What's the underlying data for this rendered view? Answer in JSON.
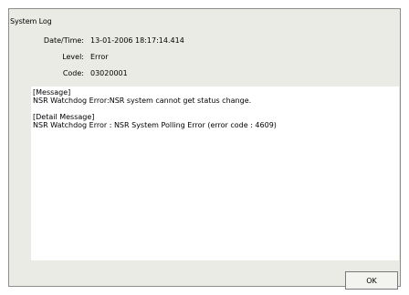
{
  "dialog": {
    "title": "System Log",
    "fields": [
      {
        "label": "Date/Time:",
        "value": "13-01-2006 18:17:14.414"
      },
      {
        "label": "Level:",
        "value": "Error"
      },
      {
        "label": "Code:",
        "value": "03020001"
      }
    ],
    "message": {
      "header": "[Message]",
      "text": "NSR Watchdog Error:NSR system cannot get status change.",
      "detail_header": "[Detail Message]",
      "detail_text": "NSR Watchdog Error : NSR System Polling Error (error code : 4609)"
    },
    "ok_label": "OK"
  }
}
